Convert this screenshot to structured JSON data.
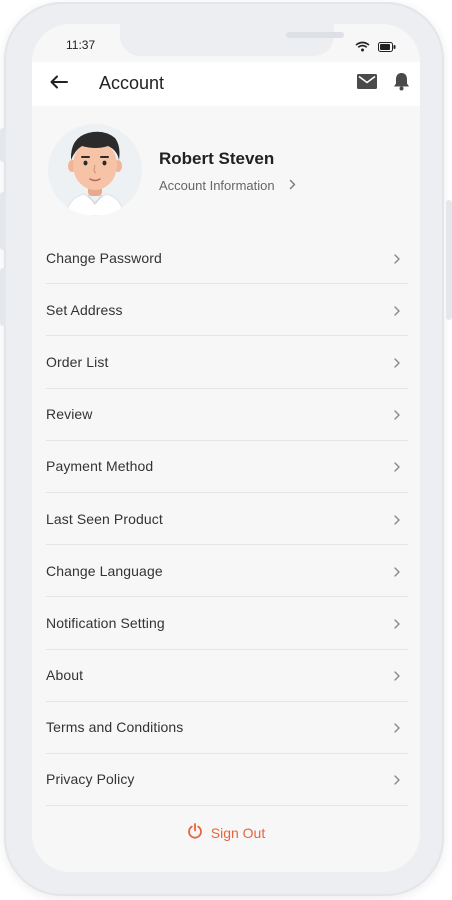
{
  "status_bar": {
    "time": "11:37"
  },
  "header": {
    "title": "Account",
    "icons": [
      "back-arrow-icon",
      "mail-icon",
      "bell-icon"
    ]
  },
  "profile": {
    "name": "Robert Steven",
    "link_label": "Account Information"
  },
  "menu": {
    "items": [
      {
        "label": "Change Password"
      },
      {
        "label": "Set Address"
      },
      {
        "label": "Order List"
      },
      {
        "label": "Review"
      },
      {
        "label": "Payment Method"
      },
      {
        "label": "Last Seen Product"
      },
      {
        "label": "Change Language"
      },
      {
        "label": "Notification Setting"
      },
      {
        "label": "About"
      },
      {
        "label": "Terms and Conditions"
      },
      {
        "label": "Privacy Policy"
      }
    ]
  },
  "footer": {
    "signout_label": "Sign Out",
    "signout_icon": "power-icon"
  },
  "colors": {
    "accent": "#e8643c",
    "background": "#f7f7f7",
    "header_bg": "#ffffff",
    "divider": "#e4e4e4"
  }
}
